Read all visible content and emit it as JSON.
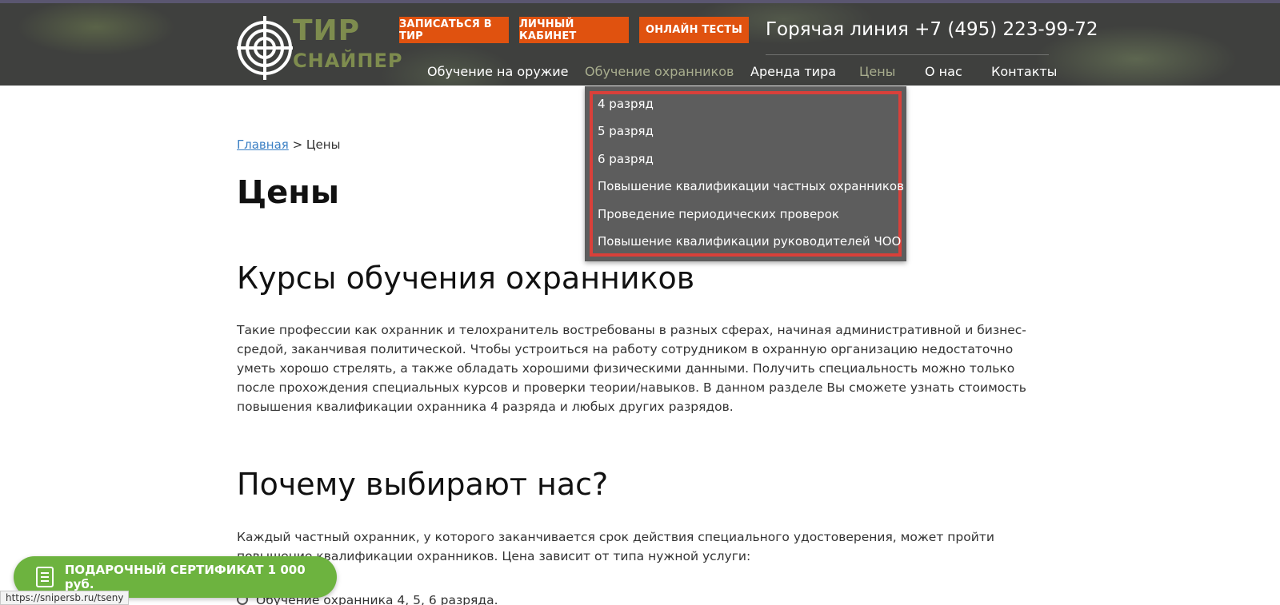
{
  "logo": {
    "line1": "ТИР",
    "line2": "СНАЙПЕР"
  },
  "top_buttons": [
    "ЗАПИСАТЬСЯ В ТИР",
    "ЛИЧНЫЙ КАБИНЕТ",
    "ОНЛАЙН ТЕСТЫ"
  ],
  "hotline": "Горячая линия +7 (495) 223-99-72",
  "nav": [
    "Обучение на оружие",
    "Обучение охранников",
    "Аренда тира",
    "Цены",
    "О нас",
    "Контакты"
  ],
  "dropdown": [
    "4 разряд",
    "5 разряд",
    "6 разряд",
    "Повышение квалификации частных охранников",
    "Проведение периодических проверок",
    "Повышение квалификации руководителей ЧОО"
  ],
  "breadcrumb": {
    "home": "Главная",
    "sep": " > ",
    "current": "Цены"
  },
  "page_title": "Цены",
  "section1": {
    "title": "Курсы обучения охранников",
    "text": "Такие профессии как охранник и телохранитель востребованы в разных сферах, начиная административной и бизнес-средой, заканчивая политической. Чтобы устроиться на работу сотрудником в охранную организацию недостаточно уметь хорошо стрелять, а также обладать хорошими физическими данными. Получить специальность можно только после прохождения специальных курсов и проверки теории/навыков. В данном разделе Вы сможете узнать стоимость повышения квалификации охранника 4 разряда и любых других разрядов."
  },
  "section2": {
    "title": "Почему выбирают нас?",
    "text": "Каждый частный охранник, у которого заканчивается срок действия специального удостоверения, может пройти повышение квалификации охранников. Цена зависит от типа нужной услуги:",
    "bullet": "Обучение охранника 4, 5, 6 разряда."
  },
  "gift_button": "ПОДАРОЧНЫЙ СЕРТИФИКАТ 1 000 руб.",
  "status_url": "https://snipersb.ru/tseny"
}
